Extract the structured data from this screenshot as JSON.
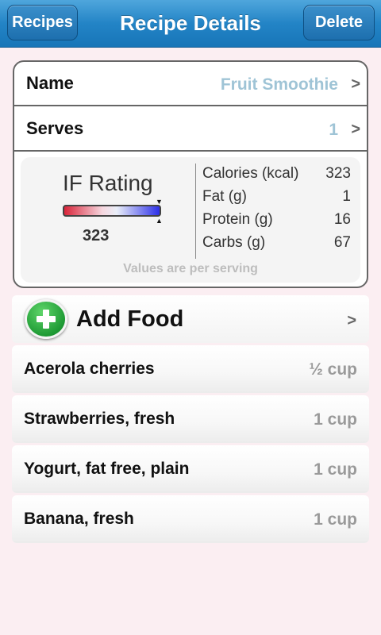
{
  "navbar": {
    "back_label": "Recipes",
    "title": "Recipe Details",
    "delete_label": "Delete"
  },
  "recipe": {
    "name_label": "Name",
    "name_value": "Fruit Smoothie",
    "serves_label": "Serves",
    "serves_value": "1",
    "chevron": ">"
  },
  "nutrition": {
    "if_rating_label": "IF Rating",
    "if_rating_value": "323",
    "if_rating_fraction": 0.95,
    "stats": [
      {
        "label": "Calories (kcal)",
        "value": "323"
      },
      {
        "label": "Fat (g)",
        "value": "1"
      },
      {
        "label": "Protein (g)",
        "value": "16"
      },
      {
        "label": "Carbs (g)",
        "value": "67"
      }
    ],
    "footnote": "Values are per serving"
  },
  "add_food": {
    "label": "Add Food",
    "chevron": ">"
  },
  "ingredients": [
    {
      "name": "Acerola cherries",
      "qty": "½ cup"
    },
    {
      "name": "Strawberries, fresh",
      "qty": "1 cup"
    },
    {
      "name": "Yogurt, fat free, plain",
      "qty": "1 cup"
    },
    {
      "name": "Banana, fresh",
      "qty": "1 cup"
    }
  ],
  "colors": {
    "nav_blue": "#2384c6",
    "background": "#fbeef2",
    "value_blue": "#9fc4d6",
    "add_green": "#1e9a34"
  }
}
